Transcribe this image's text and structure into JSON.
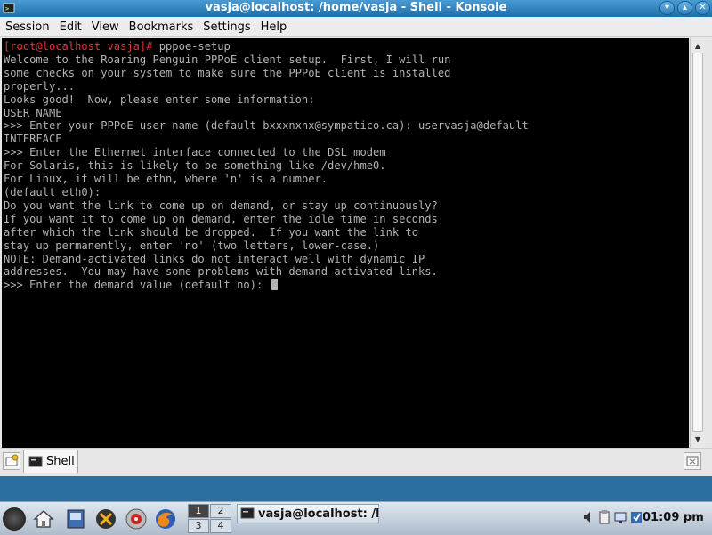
{
  "window": {
    "title": "vasja@localhost: /home/vasja - Shell - Konsole",
    "icons": {
      "app": "konsole-icon",
      "minimize": "minimize-icon",
      "maximize": "maximize-icon",
      "close": "close-icon"
    }
  },
  "menubar": {
    "items": [
      "Session",
      "Edit",
      "View",
      "Bookmarks",
      "Settings",
      "Help"
    ]
  },
  "terminal": {
    "prompt": "[root@localhost vasja]#",
    "command": " pppoe-setup",
    "prompt_color": "#e23232",
    "lines": [
      "Welcome to the Roaring Penguin PPPoE client setup.  First, I will run",
      "some checks on your system to make sure the PPPoE client is installed",
      "properly...",
      "",
      "Looks good!  Now, please enter some information:",
      "",
      "USER NAME",
      "",
      ">>> Enter your PPPoE user name (default bxxxnxnx@sympatico.ca): uservasja@default",
      "",
      "INTERFACE",
      "",
      ">>> Enter the Ethernet interface connected to the DSL modem",
      "For Solaris, this is likely to be something like /dev/hme0.",
      "For Linux, it will be ethn, where 'n' is a number.",
      "(default eth0):",
      "",
      "Do you want the link to come up on demand, or stay up continuously?",
      "If you want it to come up on demand, enter the idle time in seconds",
      "after which the link should be dropped.  If you want the link to",
      "stay up permanently, enter 'no' (two letters, lower-case.)",
      "NOTE: Demand-activated links do not interact well with dynamic IP",
      "addresses.  You may have some problems with demand-activated links."
    ],
    "current_line": ">>> Enter the demand value (default no): "
  },
  "tabbar": {
    "tab_label": "Shell",
    "icons": {
      "new_tab": "new-tab-icon",
      "tab": "terminal-icon",
      "close_tab": "close-tab-icon"
    }
  },
  "taskbar": {
    "pager": [
      "1",
      "2",
      "3",
      "4"
    ],
    "active_desktop": "1",
    "task_label": "vasja@localhost: /h",
    "clock": "01:09 pm",
    "launchers": [
      "kde-menu-icon",
      "home-icon",
      "system-settings-icon",
      "tools-icon",
      "media-icon",
      "firefox-icon"
    ],
    "tray": [
      "volume-icon",
      "clipboard-icon",
      "network-icon",
      "update-icon"
    ]
  }
}
